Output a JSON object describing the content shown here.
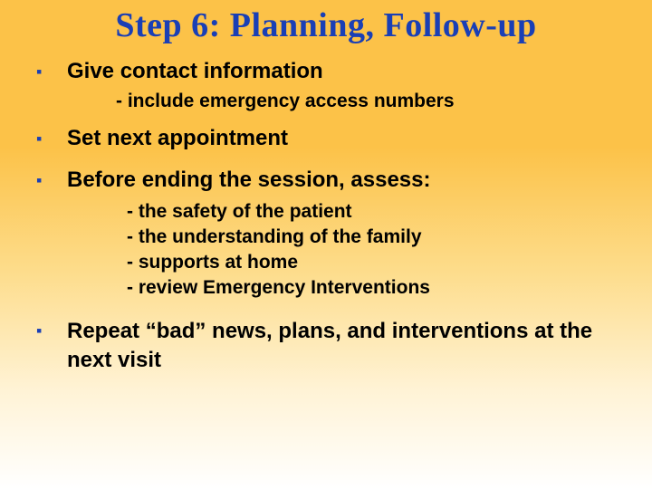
{
  "title": "Step 6: Planning, Follow-up",
  "items": [
    {
      "text": "Give contact information",
      "subs": [
        "- include emergency access numbers"
      ]
    },
    {
      "text": "Set next appointment",
      "subs": []
    },
    {
      "text": "Before ending the session, assess:",
      "subs": [
        "- the safety of the patient",
        "- the understanding of the family",
        "- supports at home",
        "- review Emergency Interventions"
      ]
    },
    {
      "text": "Repeat “bad” news, plans, and interventions at  the  next  visit",
      "subs": []
    }
  ]
}
